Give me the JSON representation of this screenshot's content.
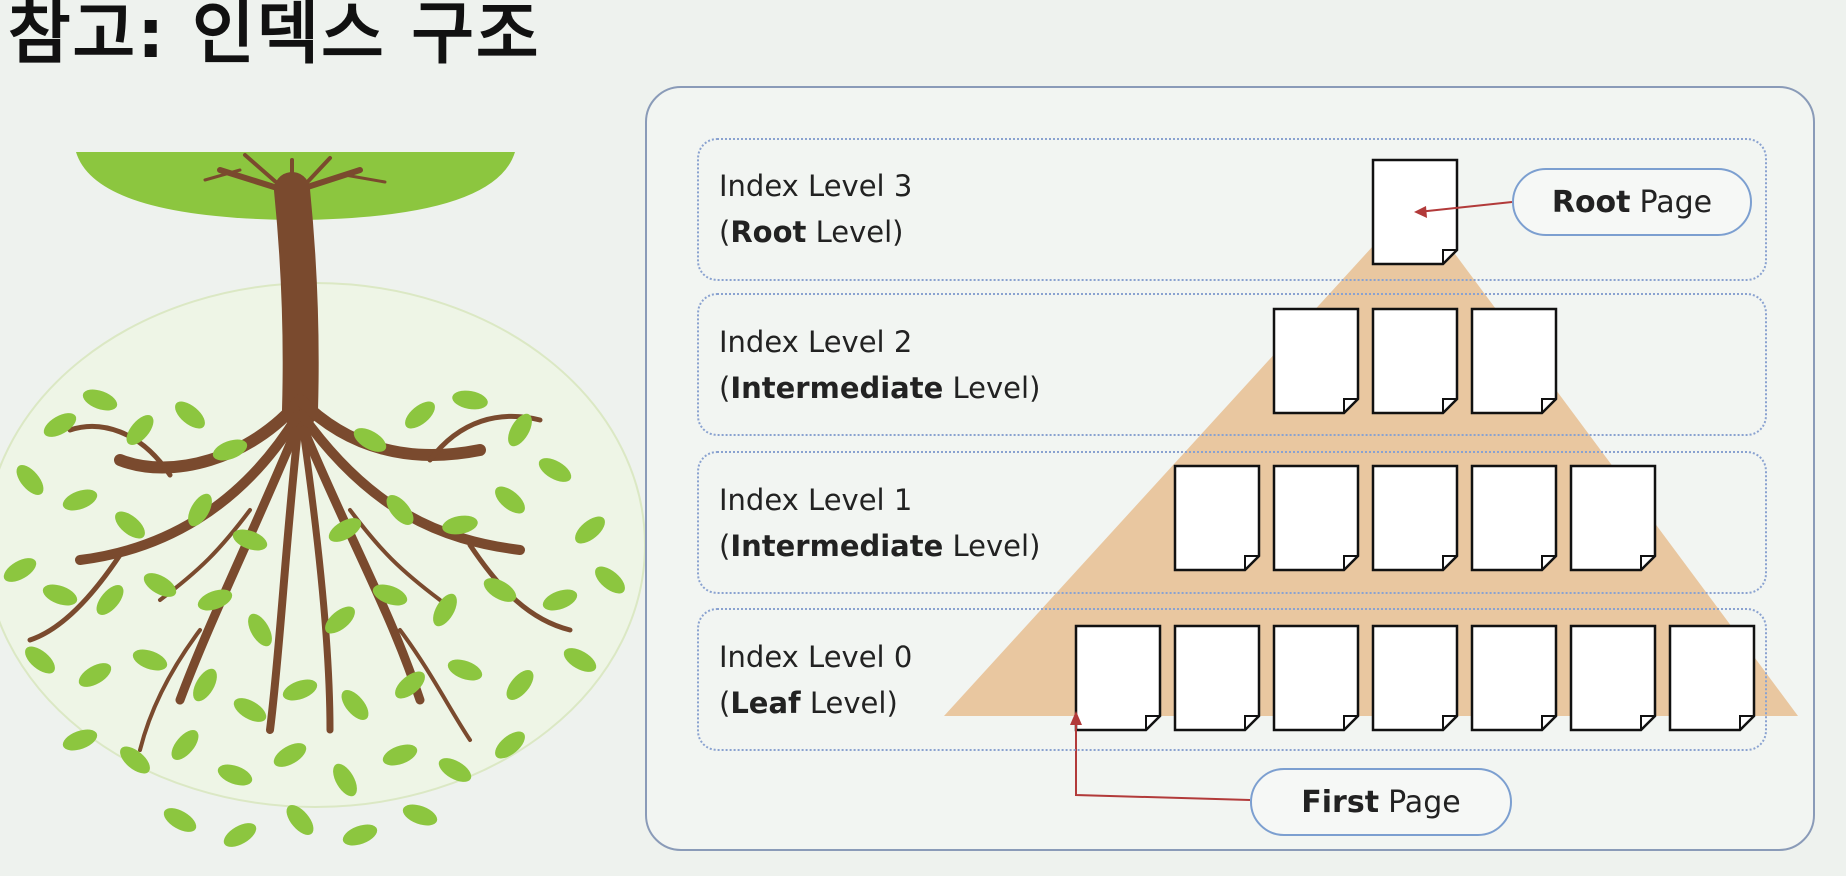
{
  "slide": {
    "title": "참고: 인덱스 구조"
  },
  "levels": [
    {
      "line1": "Index Level 3",
      "open": "(",
      "bold": "Root",
      "rest": " Level)",
      "page_count": 1
    },
    {
      "line1": "Index Level 2",
      "open": "(",
      "bold": "Intermediate",
      "rest": " Level)",
      "page_count": 3
    },
    {
      "line1": "Index Level 1",
      "open": "(",
      "bold": "Intermediate",
      "rest": " Level)",
      "page_count": 5
    },
    {
      "line1": "Index Level 0",
      "open": "(",
      "bold": "Leaf",
      "rest": " Level)",
      "page_count": 7
    }
  ],
  "callouts": {
    "root": {
      "bold": "Root",
      "rest": "Page"
    },
    "first": {
      "bold": "First",
      "rest": "Page"
    }
  },
  "colors": {
    "pyramid": "#e9c7a0",
    "arrow": "#b23a3a",
    "band_border": "#8aa2d0",
    "callout_border": "#7c9fd0",
    "canopy": "#8cc63f",
    "trunk": "#7a4a2e",
    "leaf": "#8cc63f"
  }
}
